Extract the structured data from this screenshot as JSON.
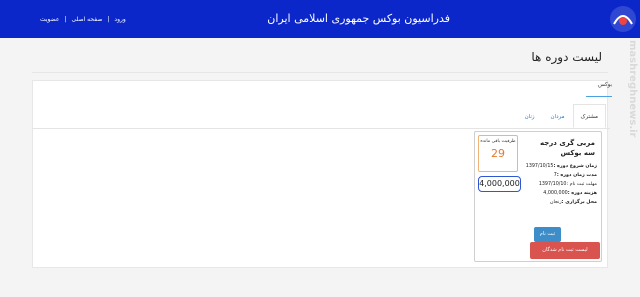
{
  "header": {
    "brand": "فدراسیون بوکس جمهوری اسلامی ایران",
    "links": [
      "ورود",
      "صفحه اصلی",
      "عضویت"
    ],
    "separator": "|"
  },
  "watermark": "mashreghnews.ir",
  "page": {
    "title": "لیست دوره ها"
  },
  "category_tab": "بوکس",
  "tabs": [
    {
      "label": "مشترک",
      "active": true
    },
    {
      "label": "مردان",
      "active": false
    },
    {
      "label": "زنان",
      "active": false
    }
  ],
  "course": {
    "name": "مربی گری درجه سه بوکس",
    "capacity_label": "ظرفیت باقی مانده",
    "capacity_value": "29",
    "price": "4,000,000",
    "start_label": "زمان شروع دوره :",
    "start_value": "1397/10/15",
    "duration_label": "مدت زمان دوره :",
    "duration_value": "7",
    "deadline_label": "مهلت ثبت نام :",
    "deadline_value": "1397/10/10",
    "fee_label": "هزینه دوره :",
    "fee_value": "4,000,000",
    "venue_label": "محل برگزاری :",
    "venue_value": "زنجان",
    "register_button": "ثبت نام",
    "list_button": "لیست ثبت نام شدگان"
  },
  "colors": {
    "navbar": "#0b27c9",
    "register": "#3d8dc9",
    "list": "#d9534f",
    "capacity": "#e8792a"
  }
}
